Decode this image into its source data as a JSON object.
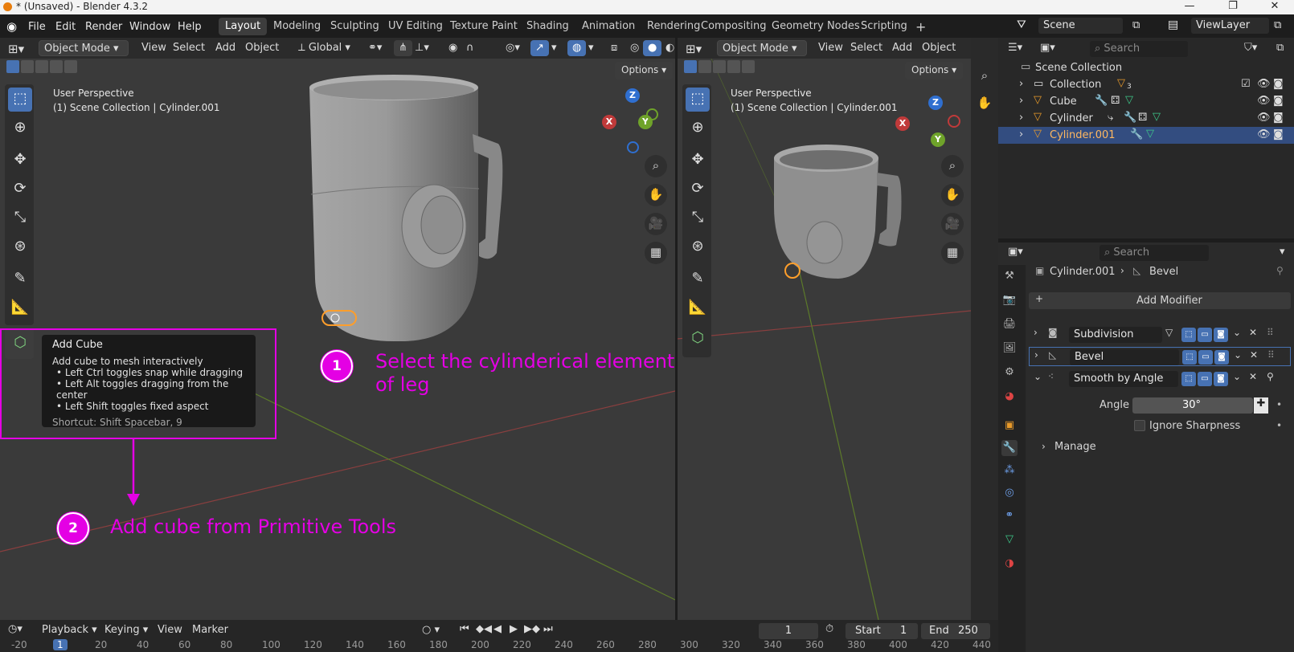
{
  "window": {
    "title": "* (Unsaved) - Blender 4.3.2",
    "min": "—",
    "max": "❐",
    "close": "✕"
  },
  "menu": [
    "File",
    "Edit",
    "Render",
    "Window",
    "Help"
  ],
  "workspaces": [
    "Layout",
    "Modeling",
    "Sculpting",
    "UV Editing",
    "Texture Paint",
    "Shading",
    "Animation",
    "Rendering",
    "Compositing",
    "Geometry Nodes",
    "Scripting"
  ],
  "workspace_add": "+",
  "scene": {
    "name": "Scene",
    "view_layer": "ViewLayer"
  },
  "viewport_left": {
    "mode": "Object Mode",
    "menus": [
      "View",
      "Select",
      "Add",
      "Object"
    ],
    "orientation": "Global",
    "options": "Options",
    "perspective": "User Perspective",
    "collection": "(1) Scene Collection | Cylinder.001"
  },
  "viewport_right": {
    "mode": "Object Mode",
    "menus": [
      "View",
      "Select",
      "Add",
      "Object"
    ],
    "options": "Options",
    "perspective": "User Perspective",
    "collection": "(1) Scene Collection | Cylinder.001"
  },
  "gizmo": {
    "x": "X",
    "y": "Y",
    "z": "Z"
  },
  "tooltip": {
    "title": "Add Cube",
    "desc": "Add cube to mesh interactively",
    "bullets": [
      "• Left Ctrl toggles snap while dragging",
      "• Left Alt toggles dragging from the center",
      "• Left Shift toggles fixed aspect"
    ],
    "shortcut": "Shortcut: Shift Spacebar, 9"
  },
  "annotations": {
    "step1_num": "1",
    "step1_line1": "Select the cylinderical element",
    "step1_line2": "of leg",
    "step2_num": "2",
    "step2_text": "Add cube from Primitive Tools"
  },
  "outliner": {
    "search_placeholder": "Search",
    "root": "Scene Collection",
    "items": [
      {
        "name": "Collection",
        "badge": "3"
      },
      {
        "name": "Cube"
      },
      {
        "name": "Cylinder"
      },
      {
        "name": "Cylinder.001"
      }
    ]
  },
  "properties": {
    "search_placeholder": "Search",
    "object": "Cylinder.001",
    "modifier": "Bevel",
    "add_modifier": "Add Modifier",
    "modifiers": [
      {
        "name": "Subdivision"
      },
      {
        "name": "Bevel"
      },
      {
        "name": "Smooth by Angle"
      }
    ],
    "angle_label": "Angle",
    "angle_value": "30°",
    "ignore_sharpness": "Ignore Sharpness",
    "manage": "Manage"
  },
  "timeline": {
    "menus": [
      "Playback",
      "Keying",
      "View",
      "Marker"
    ],
    "current_frame": "1",
    "start_label": "Start",
    "start": "1",
    "end_label": "End",
    "end": "250",
    "ticks": [
      "-20",
      "1",
      "20",
      "40",
      "60",
      "80",
      "100",
      "120",
      "140",
      "160",
      "180",
      "200",
      "220",
      "240",
      "260",
      "280",
      "300",
      "320",
      "340",
      "360",
      "380",
      "400",
      "420",
      "440"
    ]
  },
  "colors": {
    "accent": "#4772b3",
    "annotation": "#e400e4",
    "selected_text": "#ffb860"
  }
}
